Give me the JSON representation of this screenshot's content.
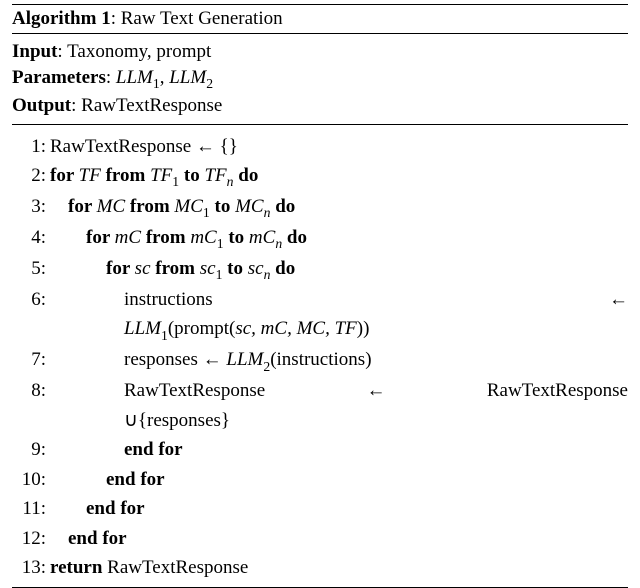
{
  "algorithm": {
    "number": "1",
    "title_prefix": "Algorithm",
    "title_suffix": ": Raw Text Generation",
    "input_label": "Input",
    "input_value": ": Taxonomy, prompt",
    "params_label": "Parameters",
    "params_value_prefix": ": ",
    "params_llm1": "LLM",
    "params_llm1_sub": "1",
    "params_comma": ", ",
    "params_llm2": "LLM",
    "params_llm2_sub": "2",
    "output_label": "Output",
    "output_value": ": RawTextResponse",
    "lines": {
      "l1": {
        "no": "1:",
        "text": "RawTextResponse ← {}"
      },
      "l2": {
        "no": "2:",
        "for": "for ",
        "v": "TF",
        "from": " from ",
        "s": "TF",
        "s_sub": "1",
        "to": " to ",
        "e": "TF",
        "e_sub": "n",
        "do": " do"
      },
      "l3": {
        "no": "3:",
        "for": "for ",
        "v": "MC",
        "from": " from ",
        "s": "MC",
        "s_sub": "1",
        "to": " to ",
        "e": "MC",
        "e_sub": "n",
        "do": " do"
      },
      "l4": {
        "no": "4:",
        "for": "for ",
        "v": "mC",
        "from": " from ",
        "s": "mC",
        "s_sub": "1",
        "to": " to ",
        "e": "mC",
        "e_sub": "n",
        "do": " do"
      },
      "l5": {
        "no": "5:",
        "for": "for ",
        "v": "sc",
        "from": " from ",
        "s": "sc",
        "s_sub": "1",
        "to": " to ",
        "e": "sc",
        "e_sub": "n",
        "do": " do"
      },
      "l6": {
        "no": "6:",
        "left": "instructions",
        "arrow": "←",
        "cont": "LLM",
        "cont_sub": "1",
        "cont_tail": "(prompt(",
        "args": "sc, mC, MC, TF",
        "close": "))"
      },
      "l7": {
        "no": "7:",
        "text_pre": "responses ← ",
        "llm": "LLM",
        "llm_sub": "2",
        "text_post": "(instructions)"
      },
      "l8": {
        "no": "8:",
        "l": "RawTextResponse",
        "m": "←",
        "r": "RawTextResponse",
        "cont": "∪{responses}"
      },
      "l9": {
        "no": "9:",
        "text": "end for"
      },
      "l10": {
        "no": "10:",
        "text": "end for"
      },
      "l11": {
        "no": "11:",
        "text": "end for"
      },
      "l12": {
        "no": "12:",
        "text": "end for"
      },
      "l13": {
        "no": "13:",
        "ret": "return ",
        "val": "RawTextResponse"
      }
    }
  }
}
